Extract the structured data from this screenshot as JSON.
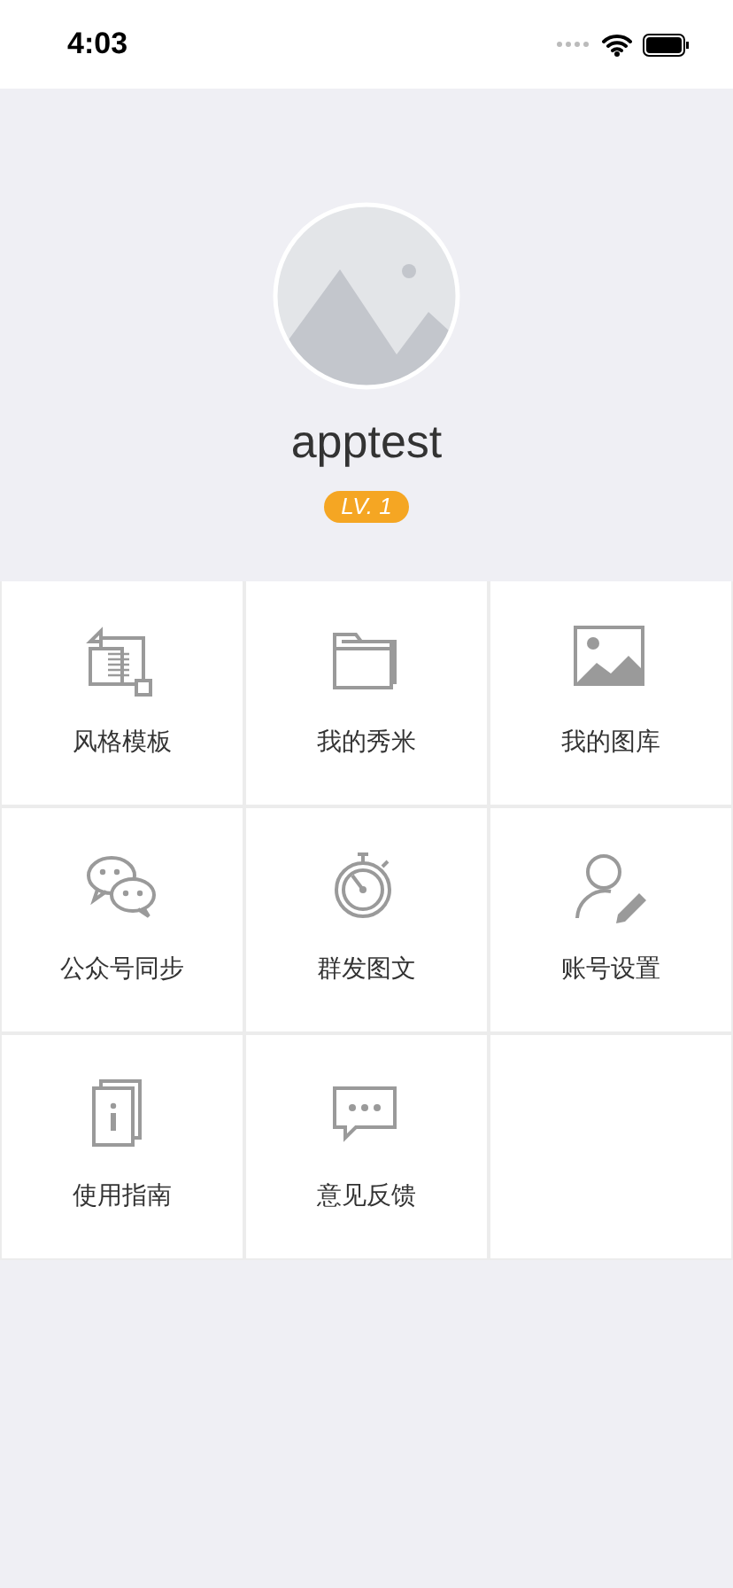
{
  "status_bar": {
    "time": "4:03"
  },
  "profile": {
    "username": "apptest",
    "level_badge": "LV. 1"
  },
  "menu": [
    {
      "label": "风格模板",
      "kind": "template"
    },
    {
      "label": "我的秀米",
      "kind": "folder"
    },
    {
      "label": "我的图库",
      "kind": "image"
    },
    {
      "label": "公众号同步",
      "kind": "chat"
    },
    {
      "label": "群发图文",
      "kind": "stopwatch"
    },
    {
      "label": "账号设置",
      "kind": "account"
    },
    {
      "label": "使用指南",
      "kind": "guide"
    },
    {
      "label": "意见反馈",
      "kind": "feedback"
    }
  ]
}
